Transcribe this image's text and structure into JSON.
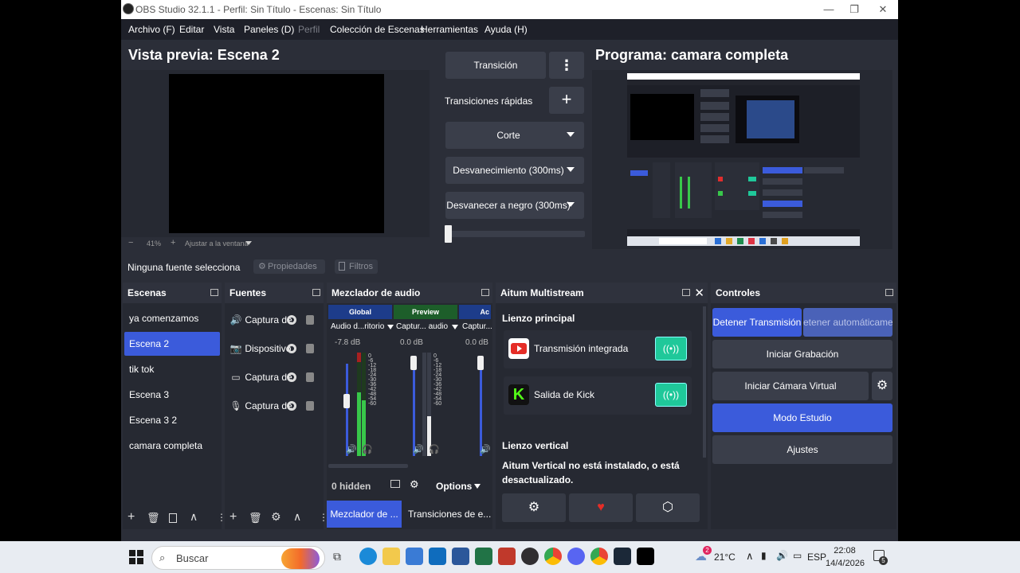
{
  "window": {
    "title": "OBS Studio 32.1.1 - Perfil: Sin Título - Escenas: Sin Título",
    "controls": [
      "—",
      "❐",
      "✕"
    ]
  },
  "menu": {
    "items": [
      "Archivo (F)",
      "Editar",
      "Vista",
      "Paneles (D)",
      "Perfil",
      "Colección de Escenas",
      "Herramientas",
      "Ayuda (H)"
    ]
  },
  "preview": {
    "title": "Vista previa: Escena 2",
    "zoom_minus": "−",
    "zoom_value": "41%",
    "zoom_plus": "+",
    "fit_label": "Ajustar a la ventana"
  },
  "transitions": {
    "transition_label": "Transición",
    "more_icon": "⋮",
    "quick_label": "Transiciones rápidas",
    "add_icon": "+",
    "options": [
      "Corte",
      "Desvanecimiento (300ms)",
      "Desvanecer a negro (300ms)"
    ]
  },
  "program": {
    "title": "Programa: camara completa"
  },
  "context_bar": {
    "no_source": "Ninguna fuente selecciona",
    "properties": "Propiedades",
    "filters": "Filtros"
  },
  "scenes": {
    "title": "Escenas",
    "items": [
      "ya comenzamos",
      "Escena 2",
      "tik tok",
      "Escena 3",
      "Escena 3 2",
      "camara completa"
    ],
    "selected": "Escena 2"
  },
  "sources": {
    "title": "Fuentes",
    "items": [
      {
        "label": "Captura de",
        "icon": "speaker-icon"
      },
      {
        "label": "Dispositivo",
        "icon": "camera-icon"
      },
      {
        "label": "Captura de",
        "icon": "window-icon"
      },
      {
        "label": "Captura de",
        "icon": "mic-icon"
      }
    ]
  },
  "mixer": {
    "title": "Mezclador de audio",
    "groups": [
      "Global",
      "Preview",
      "Ac"
    ],
    "channels": [
      {
        "name": "Audio d...ritorio",
        "db": "-7.8 dB",
        "level": 0.55
      },
      {
        "name": "Captur... audio",
        "db": "0.0 dB",
        "level": 0.0
      },
      {
        "name": "Captur...",
        "db": "0.0 dB",
        "level": 0.0
      }
    ],
    "scale": [
      "0",
      "-6",
      "-12",
      "-18",
      "-24",
      "-30",
      "-36",
      "-42",
      "-48",
      "-54",
      "-60"
    ],
    "hidden_label": "0 hidden",
    "options_label": "Options",
    "tab_active": "Mezclador de ...",
    "tab_other": "Transiciones de e..."
  },
  "multistream": {
    "title": "Aitum Multistream",
    "main_canvas": "Lienzo principal",
    "outputs": [
      "Transmisión integrada",
      "Salida de Kick"
    ],
    "vertical_canvas": "Lienzo vertical",
    "vertical_msg": "Aitum Vertical no está instalado, o está desactualizado."
  },
  "controls": {
    "title": "Controles",
    "stop_stream": "Detener Transmisión",
    "auto_stop": "etener automáticamen",
    "start_record": "Iniciar Grabación",
    "virtual_cam": "Iniciar Cámara Virtual",
    "studio_mode": "Modo Estudio",
    "settings": "Ajustes"
  },
  "taskbar": {
    "search_placeholder": "Buscar",
    "weather": "21°C",
    "language": "ESP",
    "time": "22:08",
    "date": "14/4/2026",
    "notifications": "5",
    "weather_badge": "2"
  }
}
